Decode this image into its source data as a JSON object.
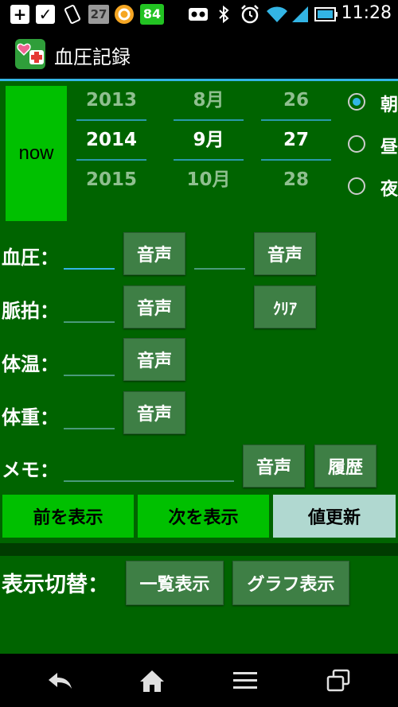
{
  "status_bar": {
    "notif_27": "27",
    "notif_84": "84",
    "time": "11:28"
  },
  "title": "血圧記録",
  "now_label": "now",
  "date_picker": {
    "year": {
      "prev": "2013",
      "current": "2014",
      "next": "2015"
    },
    "month": {
      "prev": "8月",
      "current": "9月",
      "next": "10月"
    },
    "day": {
      "prev": "26",
      "current": "27",
      "next": "28"
    }
  },
  "time_of_day": [
    {
      "label": "朝",
      "selected": true
    },
    {
      "label": "昼",
      "selected": false
    },
    {
      "label": "夜",
      "selected": false
    }
  ],
  "rows": {
    "blood_pressure": {
      "label": "血圧：",
      "voice1": "音声",
      "voice2": "音声",
      "value1": "",
      "value2": ""
    },
    "pulse": {
      "label": "脈拍：",
      "voice": "音声",
      "clear": "ｸﾘｱ",
      "value": ""
    },
    "temperature": {
      "label": "体温：",
      "voice": "音声",
      "value": ""
    },
    "weight": {
      "label": "体重：",
      "voice": "音声",
      "value": ""
    },
    "memo": {
      "label": "メモ：",
      "voice": "音声",
      "history": "履歴",
      "value": ""
    }
  },
  "nav": {
    "prev": "前を表示",
    "next": "次を表示",
    "update": "値更新"
  },
  "display_switch": {
    "label": "表示切替：",
    "list": "一覧表示",
    "graph": "グラフ表示"
  },
  "colors": {
    "background": "#006400",
    "accent": "#33b5e5",
    "button_bright": "#00c000",
    "button_dark": "#3e7f45",
    "update_button": "#b0d8d0"
  }
}
